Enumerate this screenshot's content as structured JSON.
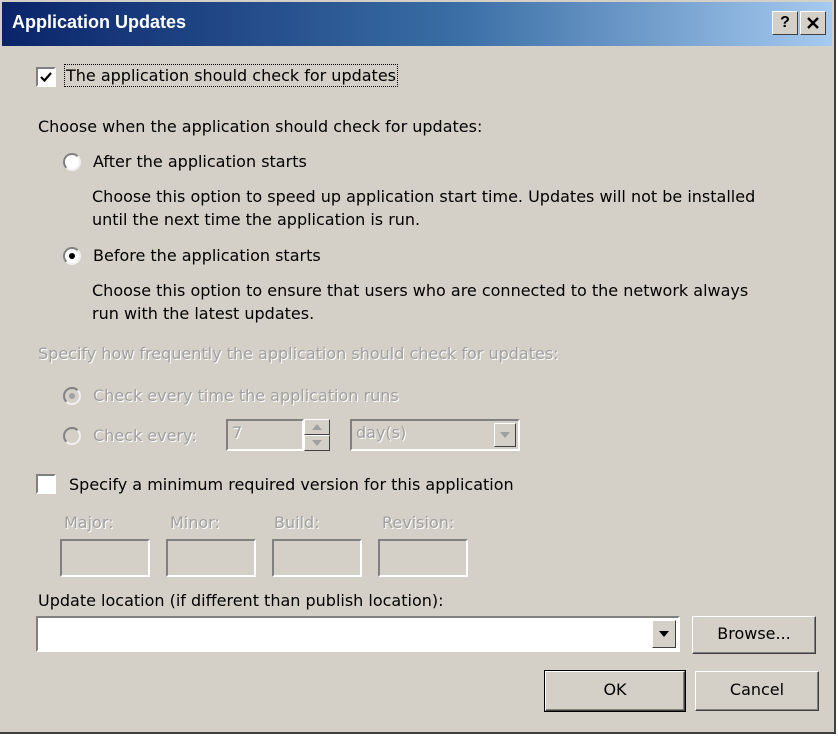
{
  "window": {
    "title": "Application Updates",
    "help_label": "?",
    "close_label": "x"
  },
  "check_updates": {
    "checked": true,
    "label": "The application should check for updates"
  },
  "when": {
    "heading": "Choose when the application should check for updates:",
    "after": {
      "label": "After the application starts",
      "selected": false,
      "description_line1": "Choose this option to speed up application start time. Updates will not be installed",
      "description_line2": "until the next time the application is run."
    },
    "before": {
      "label": "Before the application starts",
      "selected": true,
      "description_line1": "Choose this option to ensure that users who are connected to the network always",
      "description_line2": "run with the latest updates."
    }
  },
  "frequency": {
    "heading": "Specify how frequently the application should check for updates:",
    "every_run_label": "Check every time the application runs",
    "every_label": "Check every:",
    "every_value": "7",
    "unit_value": "day(s)",
    "enabled": false
  },
  "min_version": {
    "checked": false,
    "label": "Specify a minimum required version for this application",
    "fields": [
      {
        "label": "Major:",
        "value": ""
      },
      {
        "label": "Minor:",
        "value": ""
      },
      {
        "label": "Build:",
        "value": ""
      },
      {
        "label": "Revision:",
        "value": ""
      }
    ]
  },
  "location": {
    "label": "Update location (if different than publish location):",
    "value": "",
    "browse_label": "Browse..."
  },
  "buttons": {
    "ok": "OK",
    "cancel": "Cancel"
  },
  "colors": {
    "dialog_bg": "#d4d0c8",
    "title_start": "#0a246a",
    "title_end": "#a6caf0",
    "disabled_text": "#a0a0a0"
  }
}
